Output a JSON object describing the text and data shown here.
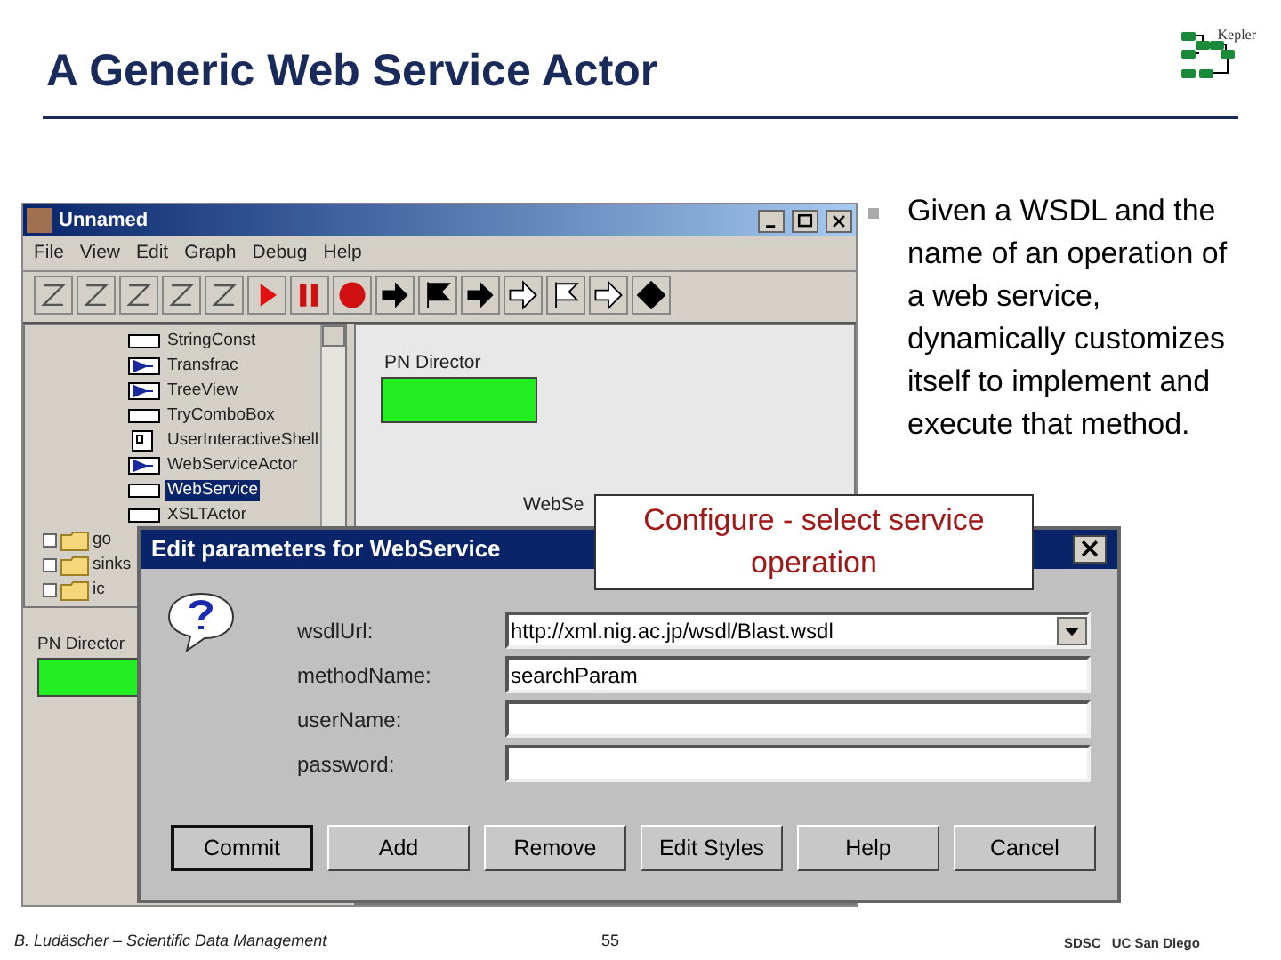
{
  "slide": {
    "title": "A Generic Web Service Actor",
    "logo_text": "Kepler"
  },
  "bullet": "Given a WSDL and the name of an operation of a web service, dynamically customizes itself to implement and execute that method.",
  "main_window": {
    "title": "Unnamed",
    "menu": [
      "File",
      "View",
      "Edit",
      "Graph",
      "Debug",
      "Help"
    ],
    "tree": [
      {
        "label": "StringConst",
        "kind": "blank",
        "selected": false
      },
      {
        "label": "Transfrac",
        "kind": "flag",
        "selected": false
      },
      {
        "label": "TreeView",
        "kind": "flag",
        "selected": false
      },
      {
        "label": "TryComboBox",
        "kind": "blank",
        "selected": false
      },
      {
        "label": "UserInteractiveShell",
        "kind": "shell",
        "selected": false
      },
      {
        "label": "WebServiceActor",
        "kind": "flag",
        "selected": false
      },
      {
        "label": "WebService",
        "kind": "blank",
        "selected": true
      },
      {
        "label": "XSLTActor",
        "kind": "blank",
        "selected": false
      }
    ],
    "folders": [
      "go",
      "sinks",
      "ic"
    ],
    "library_director": "PN Director",
    "canvas_director": "PN Director",
    "canvas_actor": "WebSe"
  },
  "callout": "Configure - select service operation",
  "dialog": {
    "title": "Edit parameters for WebService",
    "fields": [
      {
        "label": "wsdlUrl:",
        "value": "http://xml.nig.ac.jp/wsdl/Blast.wsdl",
        "kind": "dropdown"
      },
      {
        "label": "methodName:",
        "value": "searchParam",
        "kind": "text"
      },
      {
        "label": "userName:",
        "kind": "text"
      },
      {
        "label": "password:",
        "kind": "text"
      }
    ],
    "buttons": [
      {
        "label": "Commit",
        "default": true
      },
      {
        "label": "Add",
        "default": false
      },
      {
        "label": "Remove",
        "default": false
      },
      {
        "label": "Edit Styles",
        "default": false
      },
      {
        "label": "Help",
        "default": false
      },
      {
        "label": "Cancel",
        "default": false
      }
    ]
  },
  "footer": {
    "author": "B. Ludäscher – Scientific Data Management",
    "page": "55",
    "logos": [
      "SDSC",
      "UC San Diego"
    ]
  }
}
